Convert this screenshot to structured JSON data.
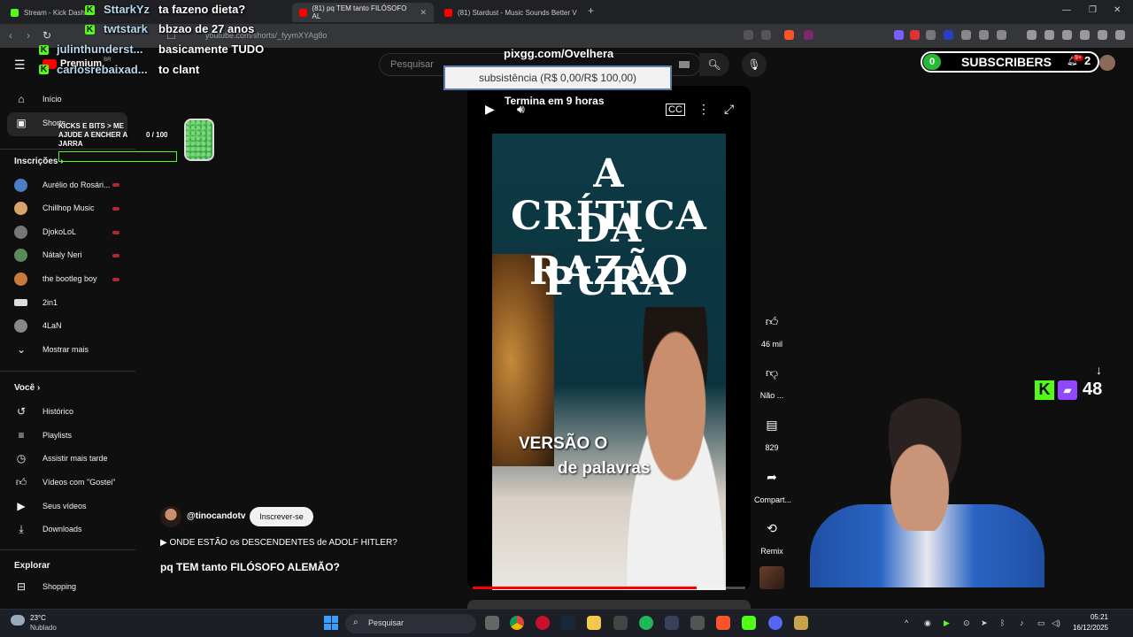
{
  "browser": {
    "tabs": [
      {
        "label": "Stream - Kick Dashi",
        "active": false
      },
      {
        "label": "(81) pq TEM tanto FILÓSOFO AL",
        "active": true
      },
      {
        "label": "(81) Stardust - Music Sounds Better V",
        "active": false
      }
    ],
    "url": "youtube.com/shorts/_fyymXYAg8o"
  },
  "youtube": {
    "premium_label": "Premium",
    "premium_region": "BR",
    "search_placeholder": "Pesquisar",
    "sidebar": {
      "top": [
        {
          "label": "Início",
          "icon": "home-icon"
        },
        {
          "label": "Shorts",
          "icon": "shorts-icon"
        }
      ],
      "subscriptions_heading": "Inscrições",
      "subscriptions": [
        {
          "label": "Aurélio do Rosári...",
          "live": true,
          "color": "#4a7fc4"
        },
        {
          "label": "Chillhop Music",
          "live": true,
          "color": "#d8a46a"
        },
        {
          "label": "DjokoLoL",
          "live": true,
          "color": "#777777"
        },
        {
          "label": "Nátaly Neri",
          "live": true,
          "color": "#5a8a5a"
        },
        {
          "label": "the bootleg boy",
          "live": true,
          "color": "#c87a3a"
        },
        {
          "label": "2in1",
          "live": false,
          "color": "#dddddd"
        },
        {
          "label": "4LaN",
          "live": false,
          "color": "#888888"
        }
      ],
      "show_more": "Mostrar mais",
      "you_heading": "Você",
      "you": [
        {
          "label": "Histórico",
          "icon": "history-icon"
        },
        {
          "label": "Playlists",
          "icon": "playlists-icon"
        },
        {
          "label": "Assistir mais tarde",
          "icon": "watch-later-icon"
        },
        {
          "label": "Vídeos com \"Gostei\"",
          "icon": "like-icon"
        },
        {
          "label": "Seus vídeos",
          "icon": "your-videos-icon"
        },
        {
          "label": "Downloads",
          "icon": "download-icon"
        }
      ],
      "explore_heading": "Explorar",
      "explore": [
        {
          "label": "Shopping",
          "icon": "shopping-icon"
        }
      ]
    },
    "short": {
      "title_lines": [
        "A CRÍTICA",
        "DA RAZÃO",
        "PURA"
      ],
      "caption_1": "VERSÃO O",
      "caption_2": "de palavras",
      "progress": 0.82,
      "actions": [
        {
          "label": "46 mil",
          "icon": "thumbs-up-icon"
        },
        {
          "label": "Não ...",
          "icon": "thumbs-down-icon"
        },
        {
          "label": "829",
          "icon": "comments-icon"
        },
        {
          "label": "Compart...",
          "icon": "share-icon"
        },
        {
          "label": "Remix",
          "icon": "remix-icon"
        }
      ],
      "channel_handle": "@tinocandotv",
      "subscribe_label": "Inscrever-se",
      "related_link": "▶ ONDE ESTÃO os DESCENDENTES de ADOLF HITLER?",
      "title": "pq TEM tanto FILÓSOFO ALEMÃO?"
    },
    "notifications_badge": "9+",
    "notifications_count": "2"
  },
  "overlay": {
    "chat": [
      {
        "user": "SttarkYz",
        "message": "ta fazeno dieta?"
      },
      {
        "user": "twtstark",
        "message": "bbzao de 27 anos"
      },
      {
        "user": "julinthunderst...",
        "message": "basicamente TUDO"
      },
      {
        "user": "carlosrebaixad...",
        "message": "to clant"
      }
    ],
    "kicks_goal": {
      "text": "KICKS E BITS > ME AJUDE A ENCHER A JARRA",
      "count": "0 / 100",
      "progress": 0.0
    },
    "pix": {
      "link": "pixgg.com/Ovelhera",
      "goal": "subsistência (R$ 0,00/R$ 100,00)",
      "timer": "Termina em 9 horas"
    },
    "subscribers": {
      "count": "0",
      "label": "SUBSCRIBERS"
    },
    "viewers": "48"
  },
  "taskbar": {
    "temperature": "23°C",
    "weather": "Nublado",
    "search_placeholder": "Pesquisar",
    "time": "05:21",
    "date": "16/12/2025"
  },
  "colors": {
    "kick_green": "#53fc18",
    "youtube_red": "#ff0000",
    "twitch_purple": "#9146ff"
  }
}
